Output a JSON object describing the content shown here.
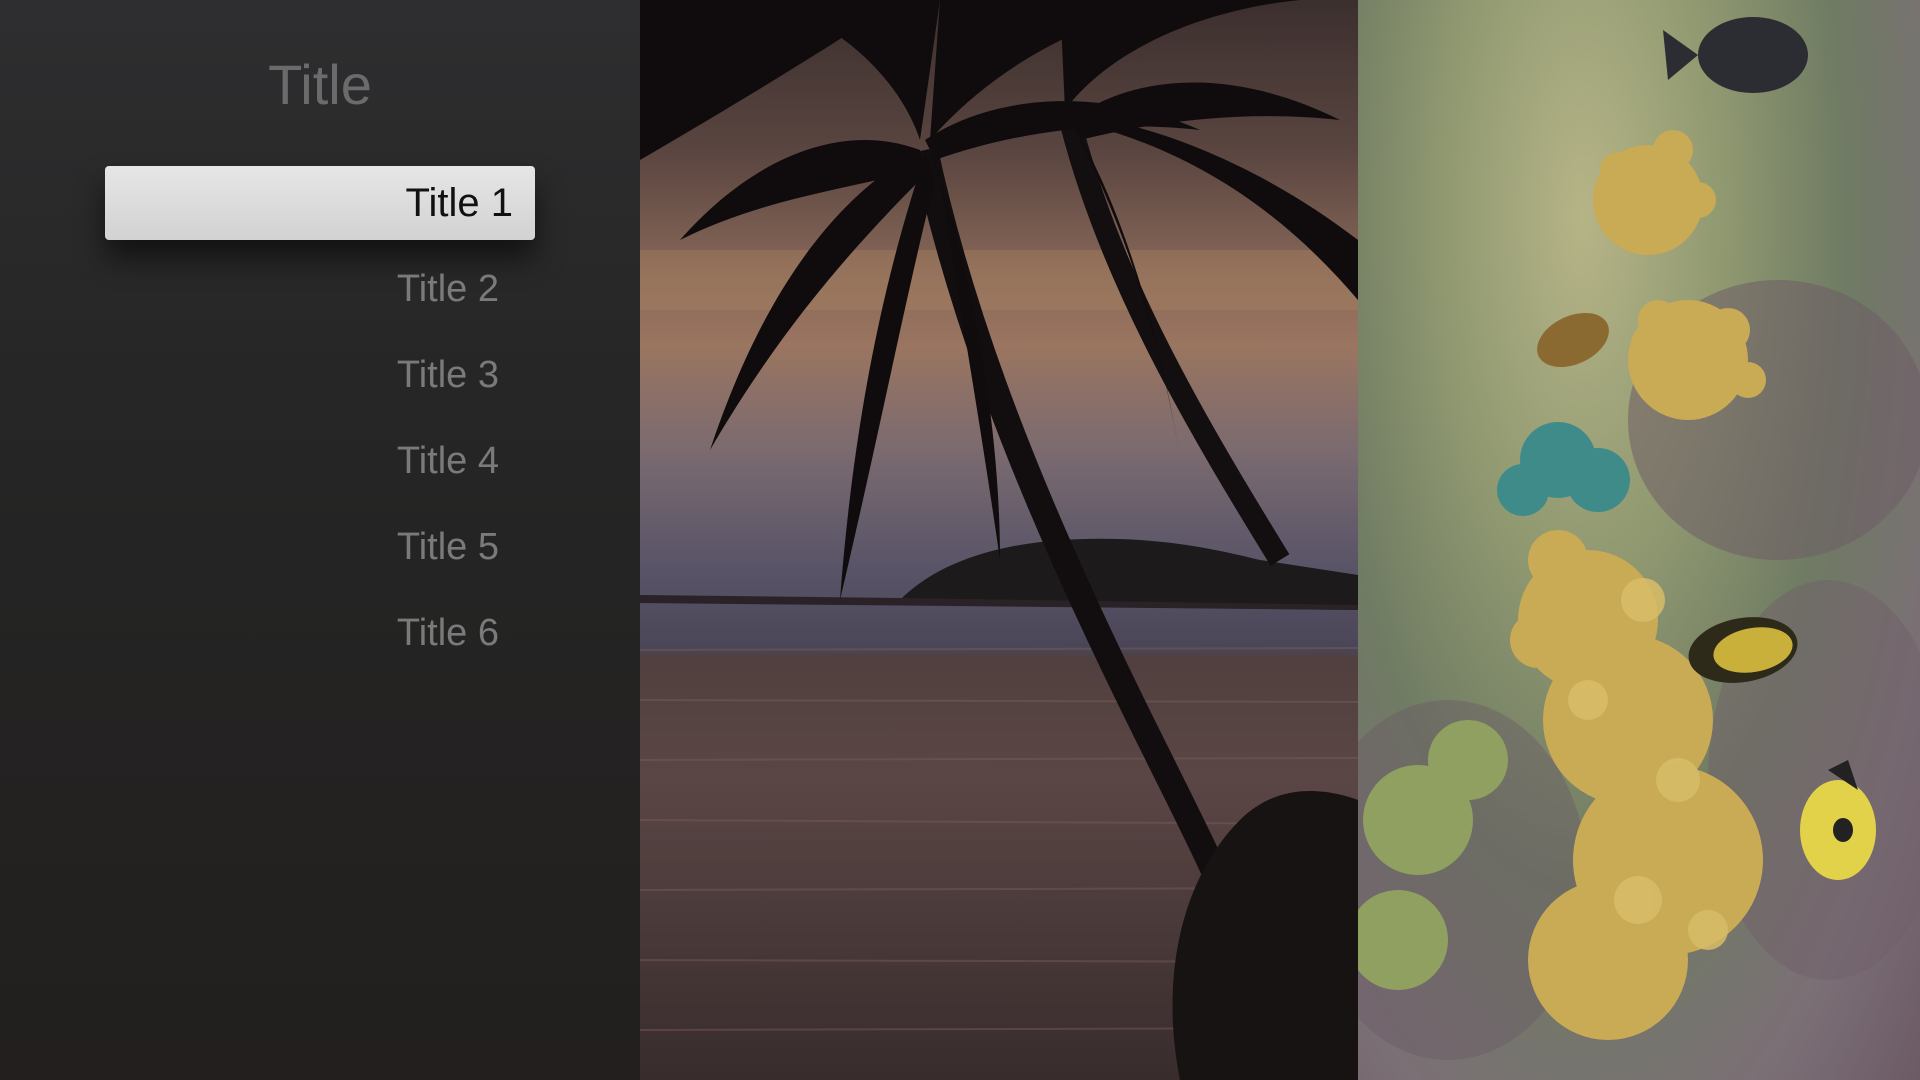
{
  "menu": {
    "title": "Title",
    "items": [
      {
        "label": "Title 1",
        "focused": true
      },
      {
        "label": "Title 2",
        "focused": false
      },
      {
        "label": "Title 3",
        "focused": false
      },
      {
        "label": "Title 4",
        "focused": false
      },
      {
        "label": "Title 5",
        "focused": false
      },
      {
        "label": "Title 6",
        "focused": false
      }
    ]
  },
  "photos": [
    {
      "subject": "palm-trees-sunset-photo"
    },
    {
      "subject": "coral-reef-fish-photo"
    }
  ],
  "colors": {
    "panel_background": "#262626",
    "focused_item_background": "#dcdcdc",
    "focused_item_text": "#111111",
    "unfocused_item_text": "#7a7a7a",
    "title_text": "#6b6b6b"
  }
}
